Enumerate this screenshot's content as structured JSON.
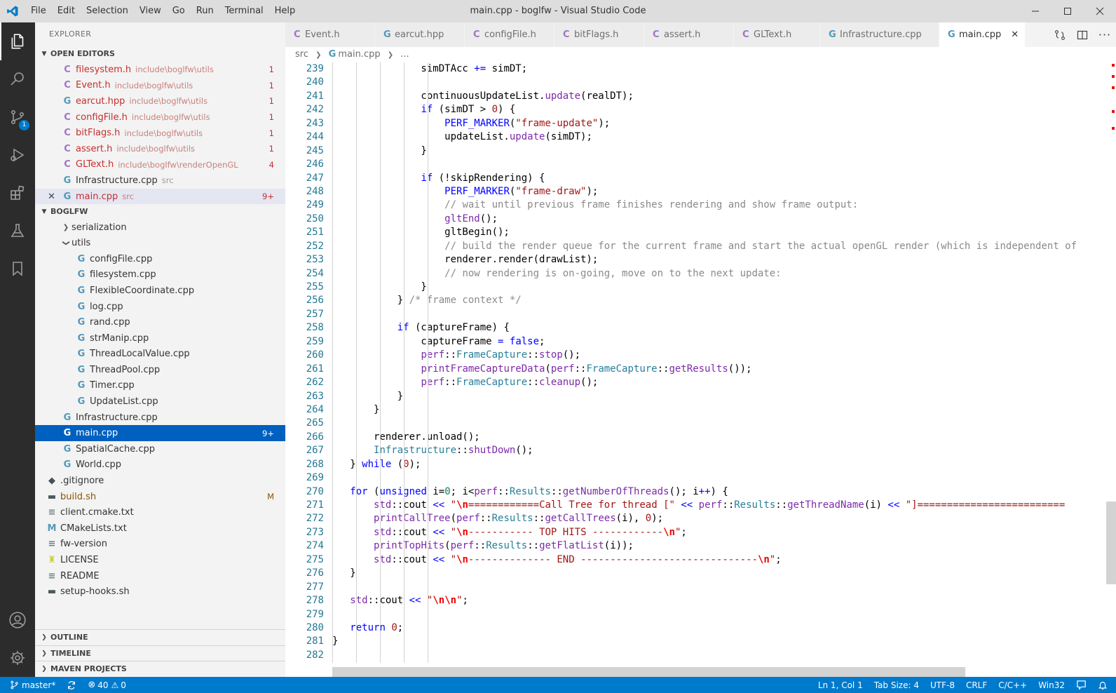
{
  "titlebar": {
    "title": "main.cpp - boglfw - Visual Studio Code",
    "menu": [
      "File",
      "Edit",
      "Selection",
      "View",
      "Go",
      "Run",
      "Terminal",
      "Help"
    ]
  },
  "activitybar": {
    "scm_badge": "1"
  },
  "sidebar": {
    "title": "EXPLORER",
    "open_editors_label": "OPEN EDITORS",
    "open_editors": [
      {
        "icon": "C",
        "name": "filesystem.h",
        "desc": "include\\boglfw\\utils",
        "badge": "1"
      },
      {
        "icon": "C",
        "name": "Event.h",
        "desc": "include\\boglfw\\utils",
        "badge": "1"
      },
      {
        "icon": "G",
        "name": "earcut.hpp",
        "desc": "include\\boglfw\\utils",
        "badge": "1"
      },
      {
        "icon": "C",
        "name": "configFile.h",
        "desc": "include\\boglfw\\utils",
        "badge": "1"
      },
      {
        "icon": "C",
        "name": "bitFlags.h",
        "desc": "include\\boglfw\\utils",
        "badge": "1"
      },
      {
        "icon": "C",
        "name": "assert.h",
        "desc": "include\\boglfw\\utils",
        "badge": "1"
      },
      {
        "icon": "C",
        "name": "GLText.h",
        "desc": "include\\boglfw\\renderOpenGL",
        "badge": "4"
      },
      {
        "icon": "G",
        "name": "Infrastructure.cpp",
        "desc": "src",
        "badge": ""
      },
      {
        "icon": "G",
        "name": "main.cpp",
        "desc": "src",
        "badge": "9+"
      }
    ],
    "folder_label": "BOGLFW",
    "tree": {
      "serialization": "serialization",
      "utils": "utils",
      "utils_files": [
        "configFile.cpp",
        "filesystem.cpp",
        "FlexibleCoordinate.cpp",
        "log.cpp",
        "rand.cpp",
        "strManip.cpp",
        "ThreadLocalValue.cpp",
        "ThreadPool.cpp",
        "Timer.cpp",
        "UpdateList.cpp"
      ],
      "infrastructure": "Infrastructure.cpp",
      "main": "main.cpp",
      "main_badge": "9+",
      "spatial": "SpatialCache.cpp",
      "world": "World.cpp",
      "gitignore": ".gitignore",
      "build": "build.sh",
      "build_badge": "M",
      "client_cmake": "client.cmake.txt",
      "cmakelists": "CMakeLists.txt",
      "fw_version": "fw-version",
      "license": "LICENSE",
      "readme": "README",
      "setup_hooks": "setup-hooks.sh"
    },
    "outline_label": "OUTLINE",
    "timeline_label": "TIMELINE",
    "maven_label": "MAVEN PROJECTS"
  },
  "tabs": [
    {
      "icon": "C",
      "label": "Event.h"
    },
    {
      "icon": "G",
      "label": "earcut.hpp"
    },
    {
      "icon": "C",
      "label": "configFile.h"
    },
    {
      "icon": "C",
      "label": "bitFlags.h"
    },
    {
      "icon": "C",
      "label": "assert.h"
    },
    {
      "icon": "C",
      "label": "GLText.h"
    },
    {
      "icon": "G",
      "label": "Infrastructure.cpp"
    },
    {
      "icon": "G",
      "label": "main.cpp"
    }
  ],
  "breadcrumb": {
    "folder": "src",
    "file": "main.cpp",
    "more": "..."
  },
  "editor": {
    "line_numbers": [
      "239",
      "240",
      "241",
      "242",
      "243",
      "244",
      "245",
      "246",
      "247",
      "248",
      "249",
      "250",
      "251",
      "252",
      "253",
      "254",
      "255",
      "256",
      "257",
      "258",
      "259",
      "260",
      "261",
      "262",
      "263",
      "264",
      "265",
      "266",
      "267",
      "268",
      "269",
      "270",
      "271",
      "272",
      "273",
      "274",
      "275",
      "276",
      "277",
      "278",
      "279",
      "280",
      "281",
      "282"
    ]
  },
  "statusbar": {
    "branch": "master*",
    "errors": "40",
    "warnings": "0",
    "position": "Ln 1, Col 1",
    "tab_size": "Tab Size: 4",
    "encoding": "UTF-8",
    "eol": "CRLF",
    "language": "C/C++",
    "platform": "Win32"
  },
  "colors": {
    "accent": "#007acc",
    "activity_bar": "#2c2c2c",
    "selection": "#0060c0",
    "error_text": "#c72e2e"
  }
}
